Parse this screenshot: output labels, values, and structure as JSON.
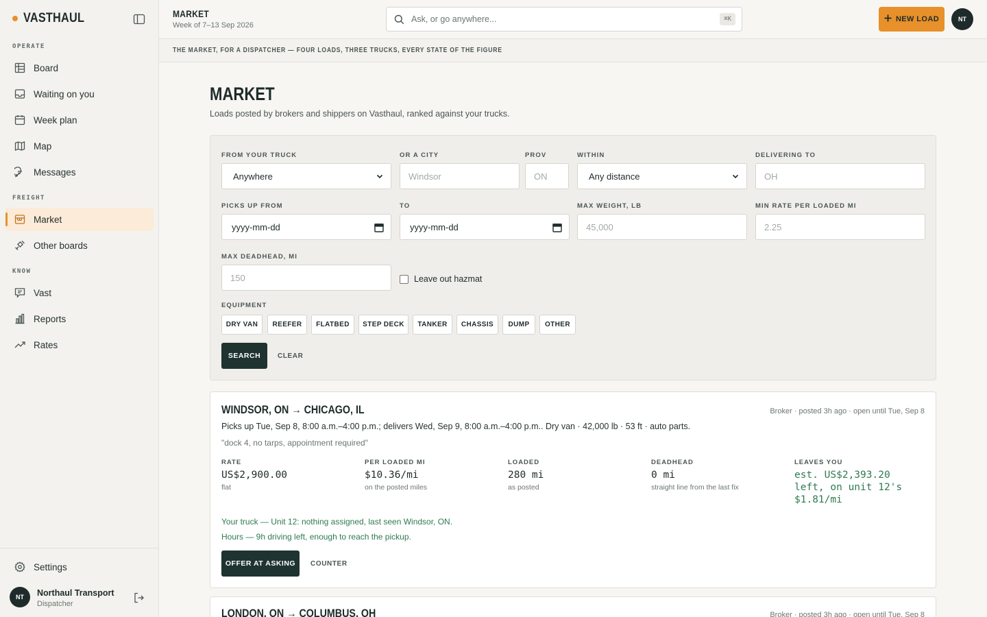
{
  "brand": {
    "name": "VASTHAUL",
    "accent": "#e8902a"
  },
  "sidebar": {
    "sections": [
      {
        "label": "OPERATE"
      },
      {
        "label": "FREIGHT"
      },
      {
        "label": "KNOW"
      }
    ],
    "items": [
      {
        "label": "Board",
        "icon": "board-icon"
      },
      {
        "label": "Waiting on you",
        "icon": "inbox-icon"
      },
      {
        "label": "Week plan",
        "icon": "calendar-icon"
      },
      {
        "label": "Map",
        "icon": "map-icon"
      },
      {
        "label": "Messages",
        "icon": "message-icon"
      },
      {
        "label": "Market",
        "icon": "store-icon",
        "active": true
      },
      {
        "label": "Other boards",
        "icon": "satellite-icon"
      },
      {
        "label": "Vast",
        "icon": "chat-icon"
      },
      {
        "label": "Reports",
        "icon": "bar-chart-icon"
      },
      {
        "label": "Rates",
        "icon": "trend-icon"
      }
    ],
    "settings_label": "Settings",
    "user": {
      "initials": "NT",
      "name": "Northaul Transport",
      "role": "Dispatcher"
    }
  },
  "topbar": {
    "title": "MARKET",
    "subtitle": "Week of 7–13 Sep 2026",
    "search_placeholder": "Ask, or go anywhere...",
    "search_shortcut": "⌘K",
    "new_load_label": "NEW LOAD",
    "avatar_initials": "NT"
  },
  "banner": "THE MARKET, FOR A DISPATCHER — FOUR LOADS, THREE TRUCKS, EVERY STATE OF THE FIGURE",
  "page": {
    "title": "MARKET",
    "subtitle": "Loads posted by brokers and shippers on Vasthaul, ranked against your trucks."
  },
  "filters": {
    "from_truck": {
      "label": "FROM YOUR TRUCK",
      "value": "Anywhere"
    },
    "city": {
      "label": "OR A CITY",
      "placeholder": "Windsor"
    },
    "prov": {
      "label": "PROV",
      "placeholder": "ON"
    },
    "within": {
      "label": "WITHIN",
      "value": "Any distance"
    },
    "delivering_to": {
      "label": "DELIVERING TO",
      "placeholder": "OH"
    },
    "picks_up_from": {
      "label": "PICKS UP FROM",
      "value": "yyyy-mm-dd"
    },
    "to": {
      "label": "TO",
      "value": "yyyy-mm-dd"
    },
    "max_weight": {
      "label": "MAX WEIGHT, LB",
      "placeholder": "45,000"
    },
    "min_rate": {
      "label": "MIN RATE PER LOADED MI",
      "placeholder": "2.25"
    },
    "max_deadhead": {
      "label": "MAX DEADHEAD, MI",
      "placeholder": "150"
    },
    "hazmat_label": "Leave out hazmat",
    "equipment_label": "EQUIPMENT",
    "equipment": [
      "DRY VAN",
      "REEFER",
      "FLATBED",
      "STEP DECK",
      "TANKER",
      "CHASSIS",
      "DUMP",
      "OTHER"
    ],
    "search_label": "SEARCH",
    "clear_label": "CLEAR"
  },
  "loads": [
    {
      "route": "WINDSOR, ON → CHICAGO, IL",
      "posted": "Broker · posted 3h ago · open until Tue, Sep 8",
      "description": "Picks up Tue, Sep 8, 8:00 a.m.–4:00 p.m.; delivers Wed, Sep 9, 8:00 a.m.–4:00 p.m.. Dry van · 42,000 lb · 53 ft · auto parts.",
      "note": "\"dock 4, no tarps, appointment required\"",
      "metrics": [
        {
          "label": "RATE",
          "value": "US$2,900.00",
          "sub": "flat"
        },
        {
          "label": "PER LOADED MI",
          "value": "$10.36/mi",
          "sub": "on the posted miles"
        },
        {
          "label": "LOADED",
          "value": "280 mi",
          "sub": "as posted"
        },
        {
          "label": "DEADHEAD",
          "value": "0 mi",
          "sub": "straight line from the last fix"
        },
        {
          "label": "LEAVES YOU",
          "value": "est. US$2,393.20 left, on unit 12's $1.81/mi",
          "sub": ""
        }
      ],
      "truck_line": "Your truck — Unit 12: nothing assigned, last seen Windsor, ON.",
      "hours_line": "Hours — 9h driving left, enough to reach the pickup.",
      "offer_label": "OFFER AT ASKING",
      "counter_label": "COUNTER"
    },
    {
      "route": "LONDON, ON → COLUMBUS, OH",
      "posted": "Broker · posted 3h ago · open until Tue, Sep 8"
    }
  ]
}
